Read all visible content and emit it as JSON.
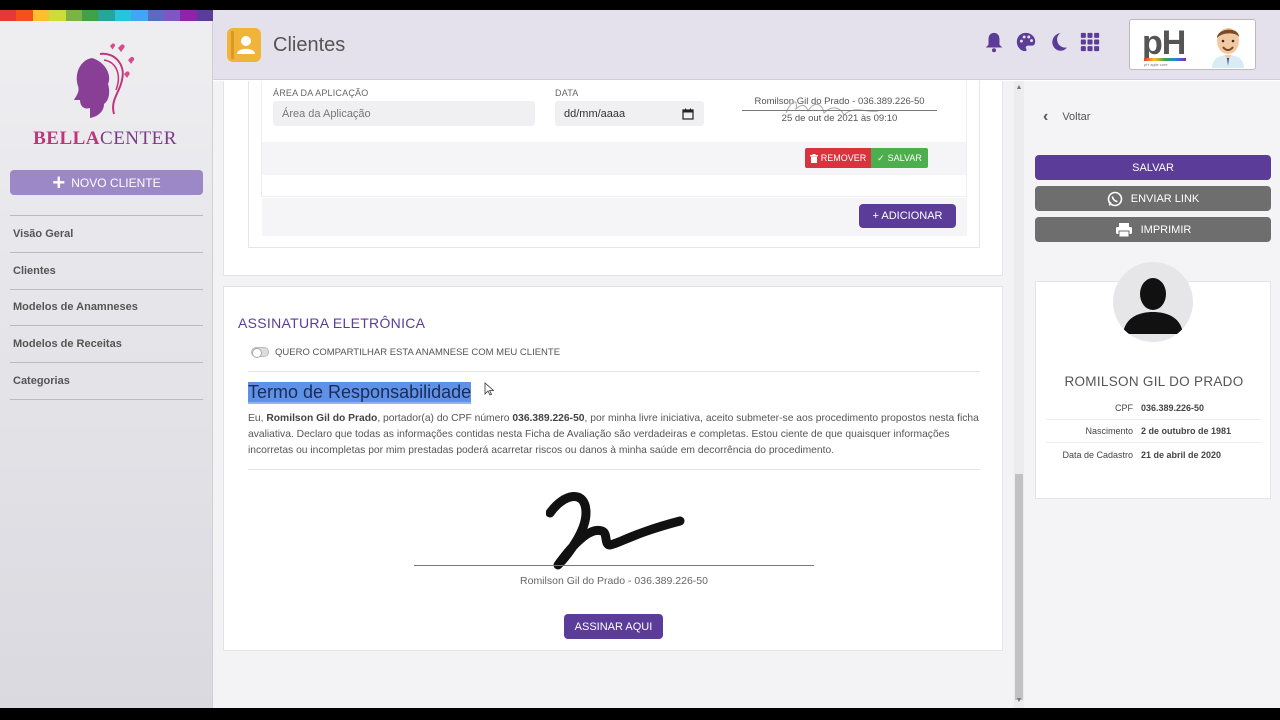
{
  "sidebar": {
    "rainbow_colors": [
      "#e53935",
      "#f4511e",
      "#fbc02d",
      "#cddc39",
      "#7cb342",
      "#43a047",
      "#26a69a",
      "#26c6da",
      "#42a5f5",
      "#5c6bc0",
      "#7e57c2",
      "#8e24aa",
      "#5b3d99"
    ],
    "logo": {
      "text_bold": "BELLA",
      "text_rest": "CENTER"
    },
    "new_client_label": "NOVO CLIENTE",
    "nav": [
      {
        "label": "Visão Geral"
      },
      {
        "label": "Clientes"
      },
      {
        "label": "Modelos de Anamneses"
      },
      {
        "label": "Modelos de Receitas"
      },
      {
        "label": "Categorias"
      }
    ]
  },
  "header": {
    "title": "Clientes",
    "icons": [
      "bell-icon",
      "palette-icon",
      "moon-icon",
      "grid-icon"
    ],
    "brand": {
      "text": "pH",
      "tag": "pH agile core"
    },
    "accent": "#5b3d99"
  },
  "application": {
    "area_label": "ÁREA DA APLICAÇÃO",
    "area_placeholder": "Área da Aplicação",
    "date_label": "DATA",
    "date_placeholder": "dd/mm/aaaa",
    "signature_name": "Romilson Gil do Prado - 036.389.226-50",
    "signature_date": "25 de out de 2021 às 09:10",
    "remove_label": "REMOVER",
    "save_label": "SALVAR",
    "add_label": "+ ADICIONAR"
  },
  "signature_section": {
    "title": "ASSINATURA ELETRÔNICA",
    "share_toggle_label": "QUERO COMPARTILHAR ESTA ANAMNESE COM MEU CLIENTE",
    "share_enabled": false,
    "terms_title": "Termo de Responsabilidade",
    "terms_prefix": "Eu, ",
    "client_name": "Romilson Gil do Prado",
    "terms_mid": ", portador(a) do CPF número ",
    "client_cpf": "036.389.226-50",
    "terms_rest": ", por minha livre iniciativa, aceito submeter-se aos procedimento propostos nesta ficha avaliativa. Declaro que todas as informações contidas nesta Ficha de Avaliação são verdadeiras e completas. Estou ciente de que quaisquer informações incorretas ou incompletas por mim prestadas poderá acarretar riscos ou danos à minha saúde em decorrência do procedimento.",
    "signature_caption": "Romilson Gil do Prado - 036.389.226-50",
    "sign_button_label": "ASSINAR AQUI"
  },
  "right_panel": {
    "back_label": "Voltar",
    "save_label": "SALVAR",
    "send_link_label": "ENVIAR LINK",
    "print_label": "IMPRIMIR",
    "client_name": "ROMILSON GIL DO PRADO",
    "details": [
      {
        "key": "CPF",
        "value": "036.389.226-50"
      },
      {
        "key": "Nascimento",
        "value": "2 de outubro de 1981"
      },
      {
        "key": "Data de Cadastro",
        "value": "21 de abril de 2020"
      }
    ]
  }
}
